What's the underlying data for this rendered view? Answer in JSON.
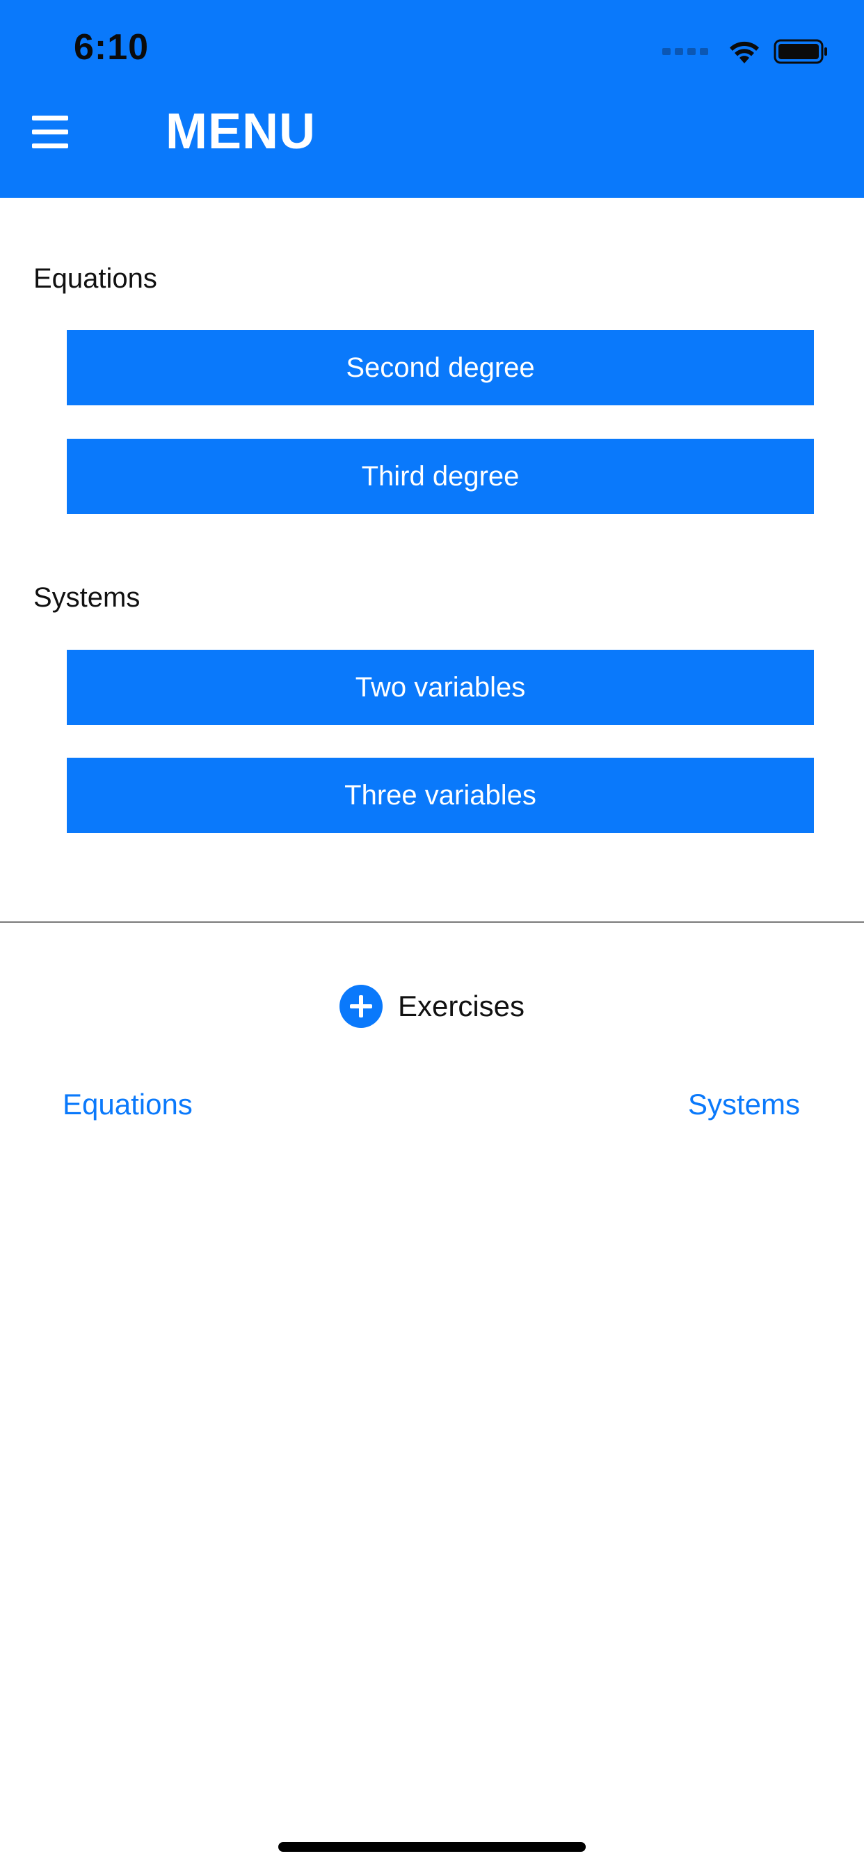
{
  "status_bar": {
    "time": "6:10",
    "icons": [
      "cellular-signal-icon",
      "wifi-icon",
      "battery-icon"
    ]
  },
  "header": {
    "title": "MENU",
    "menu_icon": "hamburger-menu-icon",
    "background_color": "#0A79FB"
  },
  "equations_section": {
    "label": "Equations",
    "buttons": [
      "Second degree",
      "Third degree"
    ]
  },
  "systems_section": {
    "label": "Systems",
    "buttons": [
      "Two variables",
      "Three variables"
    ]
  },
  "exercises": {
    "label": "Exercises",
    "icon": "plus-circle-icon"
  },
  "links": {
    "equations": "Equations",
    "systems": "Systems"
  },
  "colors": {
    "accent": "#0A79FB",
    "text": "#111111",
    "divider": "#7a7a7a"
  }
}
